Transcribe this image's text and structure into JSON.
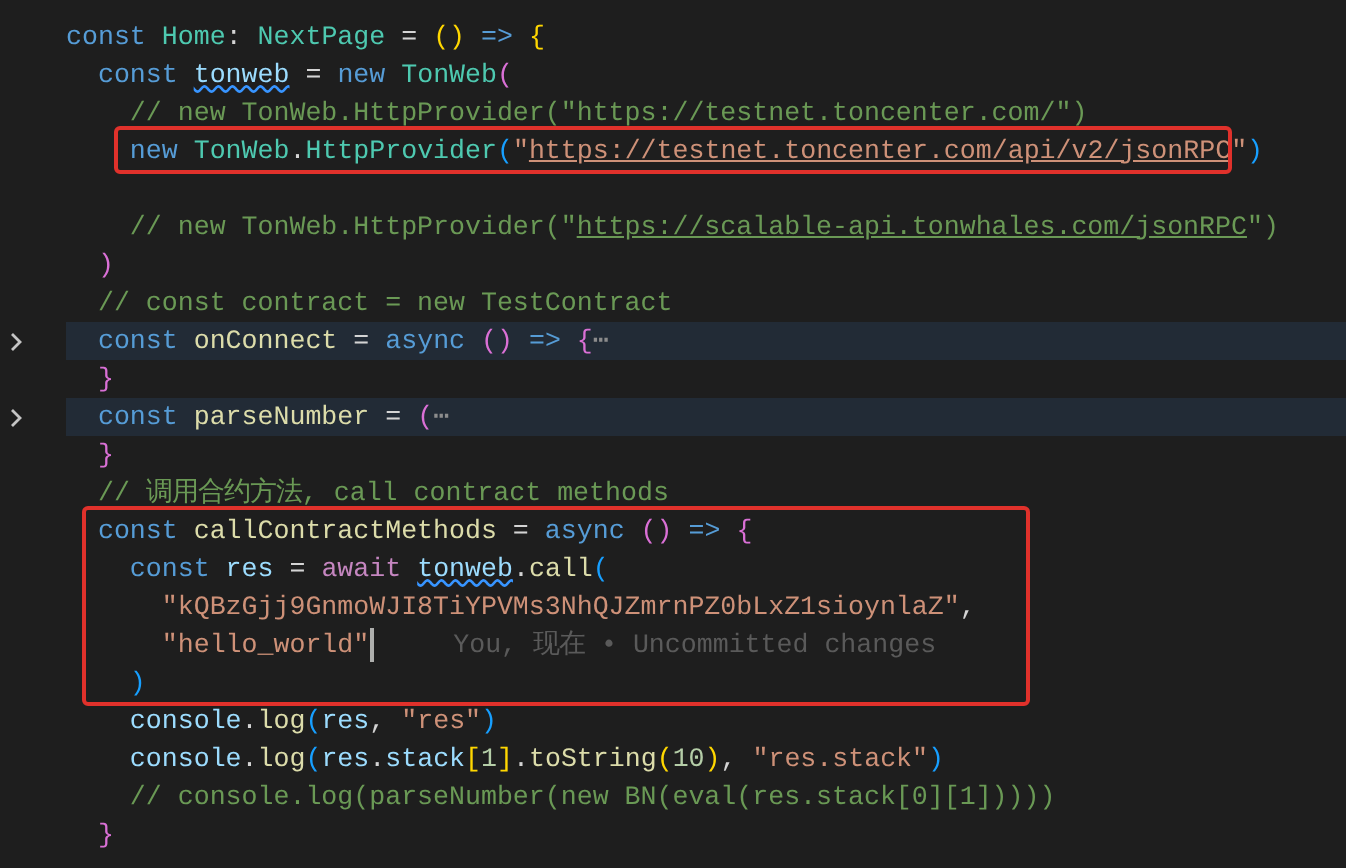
{
  "editor": {
    "blocks": [
      {
        "framed": false,
        "lines": [
          {
            "folded": false,
            "cursor": false,
            "tokens": [
              {
                "text": "const ",
                "kind": "kw"
              },
              {
                "text": "Home",
                "kind": "cls"
              },
              {
                "text": ": ",
                "kind": "punct"
              },
              {
                "text": "NextPage",
                "kind": "cls"
              },
              {
                "text": " = ",
                "kind": "punct"
              },
              {
                "text": "()",
                "kind": "b1"
              },
              {
                "text": " => ",
                "kind": "kw"
              },
              {
                "text": "{",
                "kind": "b1"
              }
            ]
          },
          {
            "folded": false,
            "cursor": false,
            "tokens": [
              {
                "text": "  const ",
                "kind": "kw"
              },
              {
                "text": "tonweb",
                "kind": "warn"
              },
              {
                "text": " = ",
                "kind": "punct"
              },
              {
                "text": "new ",
                "kind": "kw"
              },
              {
                "text": "TonWeb",
                "kind": "cls"
              },
              {
                "text": "(",
                "kind": "b2"
              }
            ]
          },
          {
            "folded": false,
            "cursor": false,
            "tokens": [
              {
                "text": "    // new TonWeb.HttpProvider(\"https://testnet.toncenter.com/\")",
                "kind": "cmt"
              }
            ]
          }
        ]
      },
      {
        "framed": true,
        "lines": [
          {
            "folded": false,
            "cursor": false,
            "tokens": [
              {
                "text": "    new ",
                "kind": "kw"
              },
              {
                "text": "TonWeb",
                "kind": "cls"
              },
              {
                "text": ".",
                "kind": "punct"
              },
              {
                "text": "HttpProvider",
                "kind": "cls"
              },
              {
                "text": "(",
                "kind": "b3"
              },
              {
                "text": "\"",
                "kind": "str"
              },
              {
                "text": "https://testnet.toncenter.com/api/v2/jsonRPC",
                "kind": "url"
              },
              {
                "text": "\"",
                "kind": "str"
              },
              {
                "text": ")",
                "kind": "b3"
              }
            ]
          }
        ]
      },
      {
        "framed": false,
        "lines": [
          {
            "folded": false,
            "cursor": false
          },
          {
            "folded": false,
            "cursor": false,
            "tokens": [
              {
                "text": "    // new TonWeb.HttpProvider(\"",
                "kind": "cmt"
              },
              {
                "text": "https://scalable-api.tonwhales.com/jsonRPC",
                "kind": "curl"
              },
              {
                "text": "\")",
                "kind": "cmt"
              }
            ]
          },
          {
            "folded": false,
            "cursor": false,
            "tokens": [
              {
                "text": "  )",
                "kind": "b2"
              }
            ]
          },
          {
            "folded": false,
            "cursor": false,
            "tokens": [
              {
                "text": "  // const contract = new TestContract",
                "kind": "cmt"
              }
            ]
          },
          {
            "folded": true,
            "cursor": false,
            "tokens": [
              {
                "text": "  const ",
                "kind": "kw"
              },
              {
                "text": "onConnect",
                "kind": "fn"
              },
              {
                "text": " = ",
                "kind": "punct"
              },
              {
                "text": "async ",
                "kind": "kw"
              },
              {
                "text": "()",
                "kind": "b2"
              },
              {
                "text": " => ",
                "kind": "kw"
              },
              {
                "text": "{",
                "kind": "b2"
              },
              {
                "text": "⋯",
                "kind": "fold"
              }
            ]
          },
          {
            "folded": false,
            "cursor": false,
            "tokens": [
              {
                "text": "  }",
                "kind": "b2"
              }
            ]
          },
          {
            "folded": true,
            "cursor": false,
            "tokens": [
              {
                "text": "  const ",
                "kind": "kw"
              },
              {
                "text": "parseNumber",
                "kind": "fn"
              },
              {
                "text": " = ",
                "kind": "punct"
              },
              {
                "text": "(",
                "kind": "b2"
              },
              {
                "text": "⋯",
                "kind": "fold"
              }
            ]
          },
          {
            "folded": false,
            "cursor": false,
            "tokens": [
              {
                "text": "  }",
                "kind": "b2"
              }
            ]
          },
          {
            "folded": false,
            "cursor": false,
            "tokens": [
              {
                "text": "  // 调用合约方法, call contract methods",
                "kind": "cmt"
              }
            ]
          }
        ]
      },
      {
        "framed": true,
        "lines": [
          {
            "folded": false,
            "cursor": false,
            "tokens": [
              {
                "text": "  const ",
                "kind": "kw"
              },
              {
                "text": "callContractMethods",
                "kind": "fn"
              },
              {
                "text": " = ",
                "kind": "punct"
              },
              {
                "text": "async ",
                "kind": "kw"
              },
              {
                "text": "()",
                "kind": "b2"
              },
              {
                "text": " => ",
                "kind": "kw"
              },
              {
                "text": "{",
                "kind": "b2"
              }
            ]
          },
          {
            "folded": false,
            "cursor": false,
            "tokens": [
              {
                "text": "    const ",
                "kind": "kw"
              },
              {
                "text": "res",
                "kind": "var"
              },
              {
                "text": " = ",
                "kind": "punct"
              },
              {
                "text": "await ",
                "kind": "ctl"
              },
              {
                "text": "tonweb",
                "kind": "warn"
              },
              {
                "text": ".",
                "kind": "punct"
              },
              {
                "text": "call",
                "kind": "fn"
              },
              {
                "text": "(",
                "kind": "b3"
              }
            ]
          },
          {
            "folded": false,
            "cursor": false,
            "tokens": [
              {
                "text": "      \"kQBzGjj9GnmoWJI8TiYPVMs3NhQJZmrnPZ0bLxZ1sioynlaZ\"",
                "kind": "str"
              },
              {
                "text": ",",
                "kind": "punct"
              }
            ]
          },
          {
            "folded": false,
            "cursor": true,
            "blame": "You, 现在 • Uncommitted changes",
            "tokens": [
              {
                "text": "      \"hello_world\"",
                "kind": "str"
              }
            ]
          },
          {
            "folded": false,
            "cursor": false,
            "tokens": [
              {
                "text": "    )",
                "kind": "b3"
              }
            ]
          }
        ]
      },
      {
        "framed": false,
        "lines": [
          {
            "folded": false,
            "cursor": false,
            "tokens": [
              {
                "text": "    console",
                "kind": "var"
              },
              {
                "text": ".",
                "kind": "punct"
              },
              {
                "text": "log",
                "kind": "fn"
              },
              {
                "text": "(",
                "kind": "b3"
              },
              {
                "text": "res",
                "kind": "var"
              },
              {
                "text": ", ",
                "kind": "punct"
              },
              {
                "text": "\"res\"",
                "kind": "str"
              },
              {
                "text": ")",
                "kind": "b3"
              }
            ]
          },
          {
            "folded": false,
            "cursor": false,
            "tokens": [
              {
                "text": "    console",
                "kind": "var"
              },
              {
                "text": ".",
                "kind": "punct"
              },
              {
                "text": "log",
                "kind": "fn"
              },
              {
                "text": "(",
                "kind": "b3"
              },
              {
                "text": "res",
                "kind": "var"
              },
              {
                "text": ".",
                "kind": "punct"
              },
              {
                "text": "stack",
                "kind": "var"
              },
              {
                "text": "[",
                "kind": "b1"
              },
              {
                "text": "1",
                "kind": "num"
              },
              {
                "text": "]",
                "kind": "b1"
              },
              {
                "text": ".",
                "kind": "punct"
              },
              {
                "text": "toString",
                "kind": "fn"
              },
              {
                "text": "(",
                "kind": "b1"
              },
              {
                "text": "10",
                "kind": "num"
              },
              {
                "text": ")",
                "kind": "b1"
              },
              {
                "text": ", ",
                "kind": "punct"
              },
              {
                "text": "\"res.stack\"",
                "kind": "str"
              },
              {
                "text": ")",
                "kind": "b3"
              }
            ]
          },
          {
            "folded": false,
            "cursor": false,
            "tokens": [
              {
                "text": "    // console.log(parseNumber(new BN(eval(res.stack[0][1]))))",
                "kind": "cmt"
              }
            ]
          },
          {
            "folded": false,
            "cursor": false,
            "tokens": [
              {
                "text": "  }",
                "kind": "b2"
              }
            ]
          }
        ]
      }
    ]
  }
}
